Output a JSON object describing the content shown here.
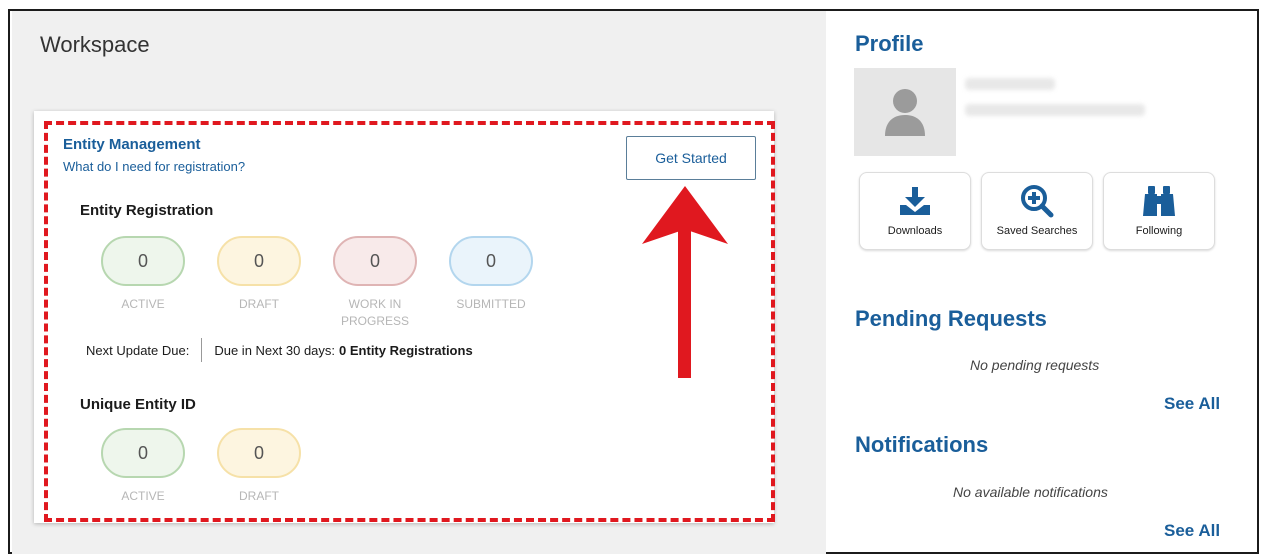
{
  "workspace": {
    "title": "Workspace",
    "entity_management": {
      "title": "Entity Management",
      "link": "What do I need for registration?",
      "get_started_label": "Get Started"
    },
    "entity_registration": {
      "title": "Entity Registration",
      "stats": [
        {
          "value": "0",
          "label": "ACTIVE"
        },
        {
          "value": "0",
          "label": "DRAFT"
        },
        {
          "value": "0",
          "label_line1": "WORK IN",
          "label_line2": "PROGRESS"
        },
        {
          "value": "0",
          "label": "SUBMITTED"
        }
      ],
      "next_update_label": "Next Update Due:",
      "due_text": "Due in Next 30 days:",
      "due_count": "0 Entity Registrations"
    },
    "unique_entity_id": {
      "title": "Unique Entity ID",
      "stats": [
        {
          "value": "0",
          "label": "ACTIVE"
        },
        {
          "value": "0",
          "label": "DRAFT"
        }
      ]
    }
  },
  "profile": {
    "title": "Profile",
    "quick_links": [
      {
        "label": "Downloads",
        "icon": "download-icon"
      },
      {
        "label": "Saved Searches",
        "icon": "search-plus-icon"
      },
      {
        "label": "Following",
        "icon": "binoculars-icon"
      }
    ]
  },
  "pending_requests": {
    "title": "Pending Requests",
    "empty_text": "No pending requests",
    "see_all": "See All"
  },
  "notifications": {
    "title": "Notifications",
    "empty_text": "No available notifications",
    "see_all": "See All"
  },
  "colors": {
    "brand_blue": "#1a5e9a",
    "highlight_red": "#e0181f"
  }
}
